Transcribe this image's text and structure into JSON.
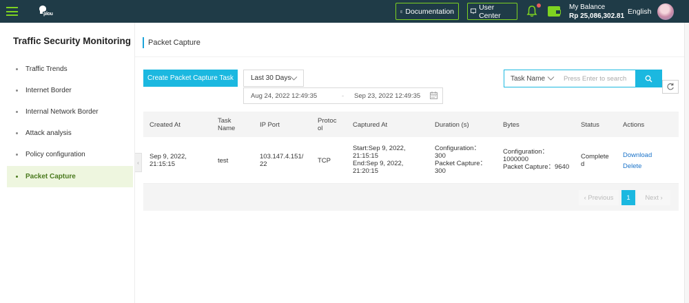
{
  "topbar": {
    "logo_text": "plou",
    "documentation_label": "Documentation",
    "user_center_label": "User Center",
    "balance_label": "My Balance",
    "balance_value": "Rp 25,086,302.81",
    "language": "English",
    "accent_color": "#7ed321",
    "background_color": "#1f3b47"
  },
  "sidebar": {
    "title": "Traffic Security Monitoring",
    "items": [
      {
        "label": "Traffic Trends",
        "active": false
      },
      {
        "label": "Internet Border",
        "active": false
      },
      {
        "label": "Internal Network Border",
        "active": false
      },
      {
        "label": "Attack analysis",
        "active": false
      },
      {
        "label": "Policy configuration",
        "active": false
      },
      {
        "label": "Packet Capture",
        "active": true
      }
    ]
  },
  "main": {
    "page_title": "Packet Capture",
    "create_button": "Create Packet Capture Task",
    "range_select": "Last 30 Days",
    "date_start": "Aug 24, 2022 12:49:35",
    "date_separator": "-",
    "date_end": "Sep 23, 2022 12:49:35",
    "search_type": "Task Name",
    "search_placeholder": "Press Enter to search",
    "primary_color": "#1bb8e0"
  },
  "table": {
    "headers": {
      "created_at": "Created At",
      "task_name_1": "Task",
      "task_name_2": "Name",
      "ip_port": "IP Port",
      "protocol_1": "Protoc",
      "protocol_2": "ol",
      "captured_at": "Captured At",
      "duration": "Duration (s)",
      "bytes": "Bytes",
      "status": "Status",
      "actions": "Actions"
    },
    "rows": [
      {
        "created_1": "Sep 9, 2022,",
        "created_2": "21:15:15",
        "task_name": "test",
        "ip_1": "103.147.4.151/",
        "ip_2": "22",
        "protocol": "TCP",
        "cap_1": "Start:Sep 9, 2022,",
        "cap_2": "21:15:15",
        "cap_3": "End:Sep 9, 2022,",
        "cap_4": "21:20:15",
        "dur_1": "Configuration：",
        "dur_2": "300",
        "dur_3": "Packet Capture：",
        "dur_4": "300",
        "bytes_1": "Configuration：",
        "bytes_2": "1000000",
        "bytes_3": "Packet Capture：9640",
        "status_1": "Complete",
        "status_2": "d",
        "action_download": "Download",
        "action_delete": "Delete"
      }
    ]
  },
  "pagination": {
    "previous": "Previous",
    "current": "1",
    "next": "Next"
  }
}
